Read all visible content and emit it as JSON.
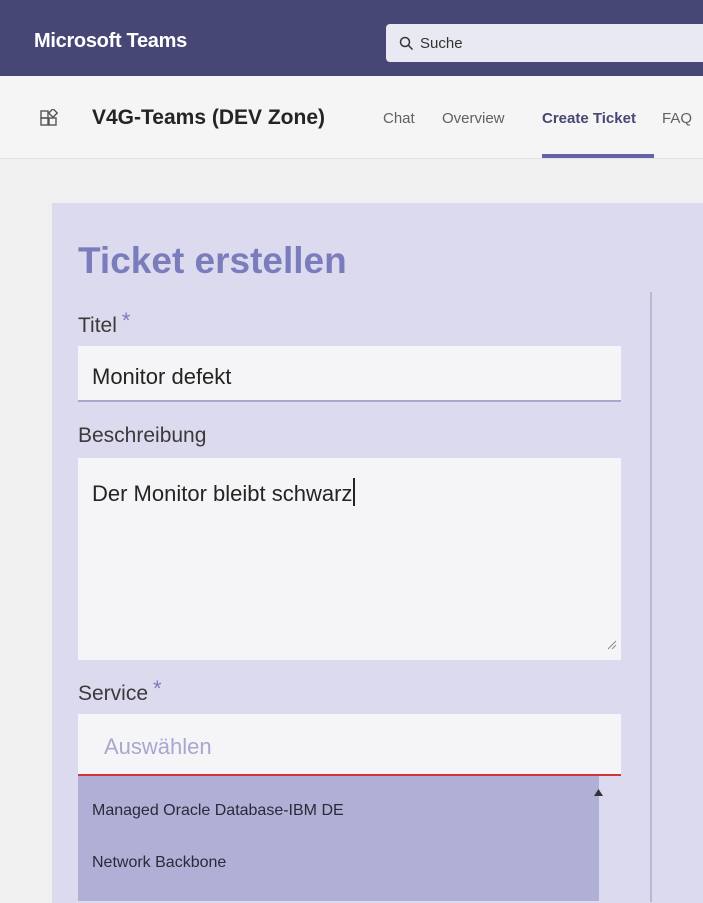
{
  "app": {
    "title": "Microsoft Teams"
  },
  "search": {
    "placeholder": "Suche"
  },
  "header": {
    "team_name": "V4G-Teams (DEV Zone)",
    "tabs": [
      {
        "label": "Chat",
        "active": false
      },
      {
        "label": "Overview",
        "active": false
      },
      {
        "label": "Create Ticket",
        "active": true
      },
      {
        "label": "FAQ",
        "active": false
      }
    ]
  },
  "form": {
    "heading": "Ticket erstellen",
    "title_label": "Titel",
    "required_mark": "*",
    "title_value": "Monitor defekt",
    "description_label": "Beschreibung",
    "description_value": "Der Monitor bleibt schwarz",
    "service_label": "Service",
    "service_placeholder": "Auswählen",
    "service_options": [
      "Managed Oracle Database-IBM DE",
      "Network Backbone"
    ]
  },
  "colors": {
    "topbar": "#464775",
    "accent": "#6264a7",
    "heading": "#7b7cbc",
    "error": "#d13438"
  }
}
